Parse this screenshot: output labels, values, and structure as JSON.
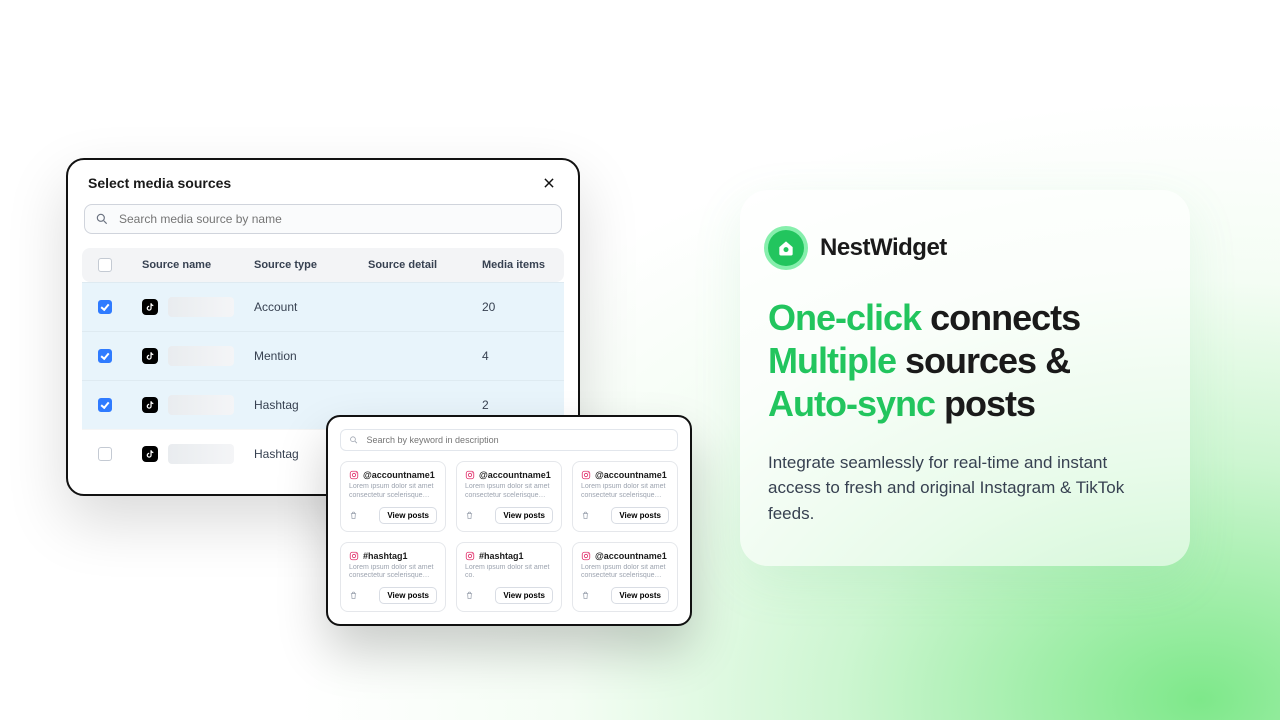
{
  "brand": {
    "name": "NestWidget"
  },
  "headline": {
    "p1_hl": "One-click",
    "p1_rest": " connects",
    "p2_hl": "Multiple",
    "p2_rest": " sources &",
    "p3_hl": "Auto-sync",
    "p3_rest": " posts"
  },
  "subcopy": "Integrate seamlessly for real-time and instant access to fresh and original Instagram & TikTok feeds.",
  "modal": {
    "title": "Select media sources",
    "search_placeholder": "Search media source by name",
    "columns": {
      "name": "Source name",
      "type": "Source type",
      "detail": "Source detail",
      "items": "Media items"
    },
    "rows": [
      {
        "checked": true,
        "type": "Account",
        "items": "20"
      },
      {
        "checked": true,
        "type": "Mention",
        "items": "4"
      },
      {
        "checked": true,
        "type": "Hashtag",
        "items": "2"
      },
      {
        "checked": false,
        "type": "Hashtag",
        "items": ""
      }
    ]
  },
  "posts": {
    "search_placeholder": "Search by keyword in description",
    "view_label": "View posts",
    "cards": [
      {
        "name": "@accountname1",
        "desc": "Lorem ipsum dolor sit amet consectetur scelerisque etiam in mau..."
      },
      {
        "name": "@accountname1",
        "desc": "Lorem ipsum dolor sit amet consectetur scelerisque etiam in mau..."
      },
      {
        "name": "@accountname1",
        "desc": "Lorem ipsum dolor sit amet consectetur scelerisque etiam in mau..."
      },
      {
        "name": "#hashtag1",
        "desc": "Lorem ipsum dolor sit amet consectetur scelerisque etiam in mo..."
      },
      {
        "name": "#hashtag1",
        "desc": "Lorem ipsum dolor sit amet co."
      },
      {
        "name": "@accountname1",
        "desc": "Lorem ipsum dolor sit amet consectetur scelerisque etiam in mau..."
      }
    ]
  }
}
